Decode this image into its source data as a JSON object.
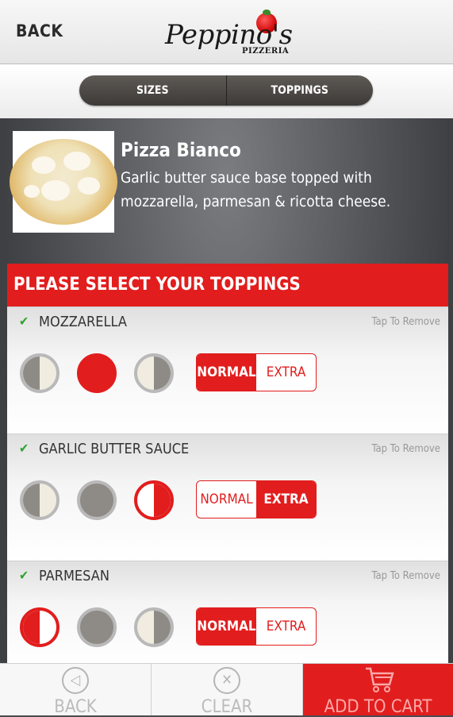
{
  "header": {
    "back_label": "BACK",
    "logo_text": "Peppino's",
    "logo_sub": "PIZZERIA"
  },
  "segments": {
    "sizes_label": "SIZES",
    "toppings_label": "TOPPINGS"
  },
  "product": {
    "name": "Pizza Bianco",
    "description": "Garlic butter sauce base topped with mozzarella, parmesan & ricotta cheese."
  },
  "toppings_panel": {
    "heading": "PLEASE SELECT YOUR TOPPINGS",
    "items": [
      {
        "name": "MOZZARELLA",
        "tap_label": "Tap To Remove",
        "coverage": "whole",
        "normal_label": "NORMAL",
        "extra_label": "EXTRA",
        "amount": "normal"
      },
      {
        "name": "GARLIC BUTTER SAUCE",
        "tap_label": "Tap To Remove",
        "coverage": "right-half",
        "normal_label": "NORMAL",
        "extra_label": "EXTRA",
        "amount": "extra"
      },
      {
        "name": "PARMESAN",
        "tap_label": "Tap To Remove",
        "coverage": "left-half",
        "normal_label": "NORMAL",
        "extra_label": "EXTRA",
        "amount": "normal"
      }
    ]
  },
  "bottom_bar": {
    "back_label": "BACK",
    "clear_label": "CLEAR",
    "cart_label": "ADD TO CART"
  },
  "colors": {
    "accent": "#e21d1d",
    "check": "#2ca52c"
  }
}
